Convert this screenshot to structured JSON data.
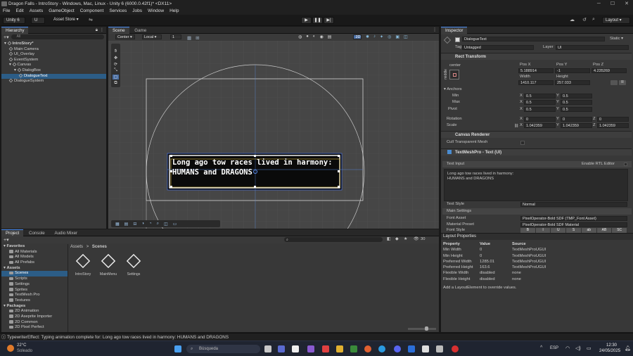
{
  "window": {
    "title": "Dragon Falls - IntroStory - Windows, Mac, Linux - Unity 6 (6000.0.42f1)* <DX11>"
  },
  "menu": [
    "File",
    "Edit",
    "Assets",
    "GameObject",
    "Component",
    "Services",
    "Jobs",
    "Window",
    "Help"
  ],
  "toolbar": {
    "account": "Unity 6",
    "user_initial": "U",
    "asset_store": "Asset Store ▾",
    "layout": "Layout ▾"
  },
  "hierarchy": {
    "tab": "Hierarchy",
    "search_placeholder": "All",
    "items": [
      {
        "label": "IntroStory*",
        "depth": 0
      },
      {
        "label": "Main Camera",
        "depth": 1
      },
      {
        "label": "UI_Overlay",
        "depth": 1
      },
      {
        "label": "EventSystem",
        "depth": 1
      },
      {
        "label": "Canvas",
        "depth": 1
      },
      {
        "label": "DialogBox",
        "depth": 2
      },
      {
        "label": "DialogueText",
        "depth": 3,
        "selected": true
      },
      {
        "label": "DialogueSystem",
        "depth": 1
      }
    ]
  },
  "scene": {
    "tabs": [
      "Scene",
      "Game"
    ],
    "pivot": "Center ▾",
    "space": "Local ▾",
    "snap": "1",
    "mode_2d": "2D",
    "dialogue_line1": "Long ago tow races lived in harmony:",
    "dialogue_line2": "HUMANS and DRAGONS"
  },
  "inspector": {
    "tab": "Inspector",
    "object_name": "DialogueText",
    "static": "Static ▾",
    "tag_label": "Tag",
    "tag_value": "Untagged",
    "layer_label": "Layer",
    "layer_value": "UI",
    "rect_transform": "Rect Transform",
    "anchor_preset": "center",
    "side_label": "middle",
    "pos_x_label": "Pos X",
    "pos_y_label": "Pos Y",
    "pos_z_label": "Pos Z",
    "pos_x": "5.188914",
    "pos_y": "-1",
    "pos_z": "4.235269",
    "width_label": "Width",
    "height_label": "Height",
    "width": "1410.117",
    "height": "257.033",
    "anchors": "Anchors",
    "min": "Min",
    "max": "Max",
    "pivot": "Pivot",
    "min_x": "0.5",
    "min_y": "0.5",
    "max_x": "0.5",
    "max_y": "0.5",
    "pivot_x": "0.5",
    "pivot_y": "0.5",
    "x": "X",
    "y": "Y",
    "z": "Z",
    "rotation": "Rotation",
    "rot_x": "0",
    "rot_y": "0",
    "rot_z": "0",
    "scale": "Scale",
    "scale_x": "1.042359",
    "scale_y": "1.042359",
    "scale_z": "1.042359",
    "canvas_renderer": "Canvas Renderer",
    "cull_mesh": "Cull Transparent Mesh",
    "tmp_header": "TextMeshPro - Text (UI)",
    "text_input": "Text Input",
    "enable_rtl": "Enable RTL Editor",
    "text_value_line1": "Long ago tow races lived in harmony:",
    "text_value_line2": "HUMANS and DRAGONS",
    "text_style_label": "Text Style",
    "text_style": "Normal",
    "main_settings": "Main Settings",
    "font_asset_label": "Font Asset",
    "font_asset": "PixelOperator-Bold SDF (TMP_Font Asset)",
    "material_label": "Material Preset",
    "material": "PixelOperator-Bold SDF Material",
    "font_style_label": "Font Style",
    "font_style_buttons": [
      "B",
      "I",
      "U",
      "S",
      "ab",
      "AB",
      "SC"
    ]
  },
  "layout_props": {
    "title": "Layout Properties",
    "headers": [
      "Property",
      "Value",
      "Source"
    ],
    "rows": [
      [
        "Min Width",
        "0",
        "TextMeshProUGUI"
      ],
      [
        "Min Height",
        "0",
        "TextMeshProUGUI"
      ],
      [
        "Preferred Width",
        "1285.01",
        "TextMeshProUGUI"
      ],
      [
        "Preferred Height",
        "163.6",
        "TextMeshProUGUI"
      ],
      [
        "Flexible Width",
        "disabled",
        "none"
      ],
      [
        "Flexible Height",
        "disabled",
        "none"
      ]
    ],
    "hint": "Add a LayoutElement to override values."
  },
  "project": {
    "tabs": [
      "Project",
      "Console",
      "Audio Mixer"
    ],
    "hidden_count": "30",
    "tree": [
      {
        "label": "Favorites",
        "depth": 0,
        "bold": true
      },
      {
        "label": "All Materials",
        "depth": 1
      },
      {
        "label": "All Models",
        "depth": 1
      },
      {
        "label": "All Prefabs",
        "depth": 1
      },
      {
        "label": "Assets",
        "depth": 0,
        "bold": true
      },
      {
        "label": "Scenes",
        "depth": 1,
        "selected": true
      },
      {
        "label": "Scripts",
        "depth": 1
      },
      {
        "label": "Settings",
        "depth": 1
      },
      {
        "label": "Sprites",
        "depth": 1
      },
      {
        "label": "TextMesh Pro",
        "depth": 1
      },
      {
        "label": "Textures",
        "depth": 1
      },
      {
        "label": "Packages",
        "depth": 0,
        "bold": true
      },
      {
        "label": "2D Animation",
        "depth": 1
      },
      {
        "label": "2D Aseprite Importer",
        "depth": 1
      },
      {
        "label": "2D Common",
        "depth": 1
      },
      {
        "label": "2D Pixel Perfect",
        "depth": 1
      }
    ],
    "breadcrumb_root": "Assets",
    "breadcrumb_sep": ">",
    "breadcrumb_current": "Scenes",
    "files": [
      "IntroStory",
      "MainMenu",
      "Settings"
    ]
  },
  "status": {
    "message": "TypewriterEffect: Typing animation complete for: Long ago tow races lived in harmony:  HUMANS and DRAGONS"
  },
  "taskbar": {
    "temp": "22°C",
    "weather": "Soleado",
    "search": "Búsqueda",
    "lang": "ESP",
    "time": "12:30",
    "date": "24/05/2025"
  }
}
